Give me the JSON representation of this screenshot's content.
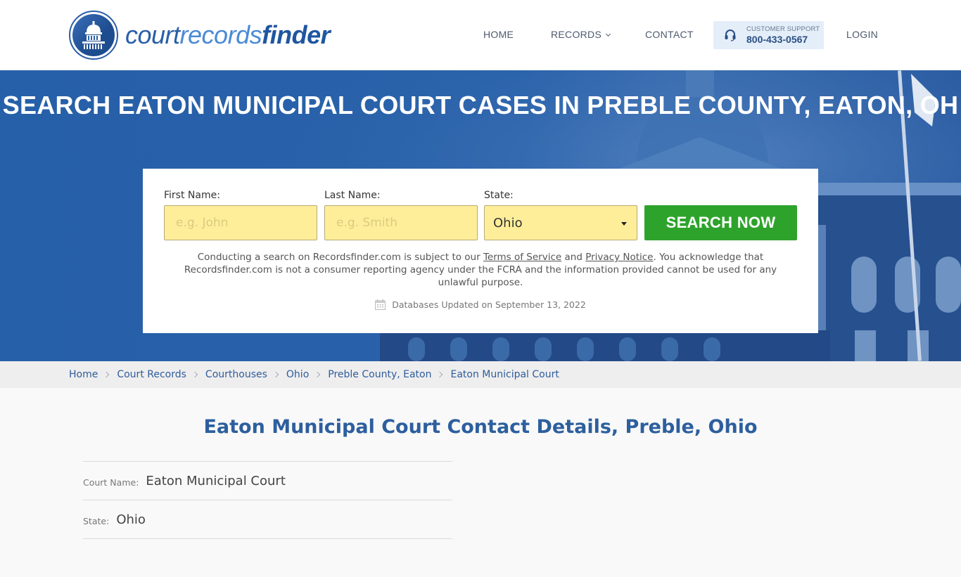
{
  "brand": {
    "logo_parts": [
      "court",
      "records",
      "finder"
    ]
  },
  "nav": {
    "home": "HOME",
    "records": "RECORDS",
    "contact": "CONTACT",
    "support_label": "CUSTOMER SUPPORT",
    "support_phone": "800-433-0567",
    "login": "LOGIN"
  },
  "hero": {
    "title": "SEARCH EATON MUNICIPAL COURT CASES IN PREBLE COUNTY, EATON, OH"
  },
  "search": {
    "first_name_label": "First Name:",
    "first_name_placeholder": "e.g. John",
    "first_name_value": "",
    "last_name_label": "Last Name:",
    "last_name_placeholder": "e.g. Smith",
    "last_name_value": "",
    "state_label": "State:",
    "state_value": "Ohio",
    "button": "SEARCH NOW",
    "colors": {
      "input_bg": "#ffee99",
      "button_bg": "#2ea32c"
    }
  },
  "disclaimer": {
    "part1": "Conducting a search on Recordsfinder.com is subject to our ",
    "terms_link": "Terms of Service",
    "part2": " and ",
    "privacy_link": "Privacy Notice",
    "part3": ". You acknowledge that Recordsfinder.com is not a consumer reporting agency under the FCRA and the information provided cannot be used for any unlawful purpose."
  },
  "updated": {
    "icon": "calendar-icon",
    "text": "Databases Updated on September 13, 2022"
  },
  "breadcrumb": [
    {
      "label": "Home"
    },
    {
      "label": "Court Records"
    },
    {
      "label": "Courthouses"
    },
    {
      "label": "Ohio"
    },
    {
      "label": "Preble County, Eaton"
    },
    {
      "label": "Eaton Municipal Court"
    }
  ],
  "main": {
    "title": "Eaton Municipal Court Contact Details, Preble, Ohio",
    "details": [
      {
        "label": "Court Name:",
        "value": "Eaton Municipal Court"
      },
      {
        "label": "State:",
        "value": "Ohio"
      }
    ]
  }
}
